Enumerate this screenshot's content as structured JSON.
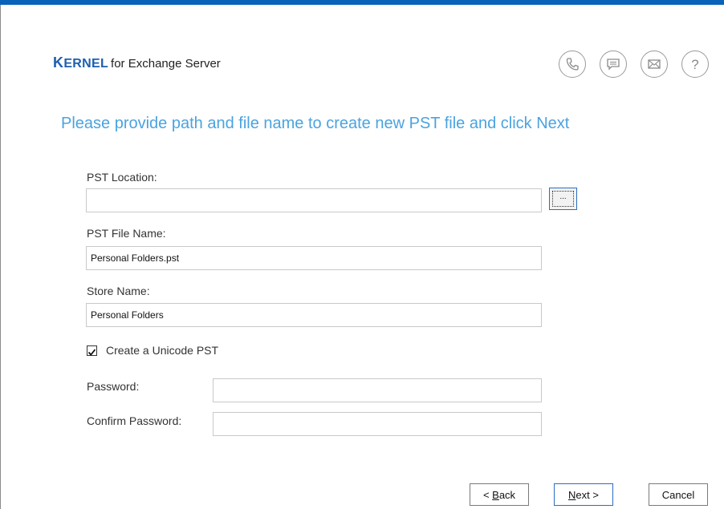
{
  "brand": {
    "logo_k": "K",
    "logo_rest": "ERNEL",
    "suffix": "for Exchange Server"
  },
  "header_icons": [
    "phone-icon",
    "chat-icon",
    "mail-icon",
    "help-icon"
  ],
  "heading": "Please provide path and file name to create new PST file and click Next",
  "form": {
    "pst_location": {
      "label": "PST Location:",
      "value": ""
    },
    "browse_label": "...",
    "pst_file_name": {
      "label": "PST File Name:",
      "value": "Personal Folders.pst"
    },
    "store_name": {
      "label": "Store Name:",
      "value": "Personal Folders"
    },
    "unicode": {
      "label": "Create a Unicode PST",
      "checked": true
    },
    "password": {
      "label": "Password:",
      "value": ""
    },
    "confirm_password": {
      "label": "Confirm Password:",
      "value": ""
    }
  },
  "buttons": {
    "back": {
      "prefix": "< ",
      "mnemonic": "B",
      "rest": "ack"
    },
    "next": {
      "mnemonic": "N",
      "rest": "ext >"
    },
    "cancel": "Cancel"
  },
  "colors": {
    "top_bar": "#0a63b8",
    "heading": "#4aa3e0",
    "logo": "#1e5fb0"
  }
}
